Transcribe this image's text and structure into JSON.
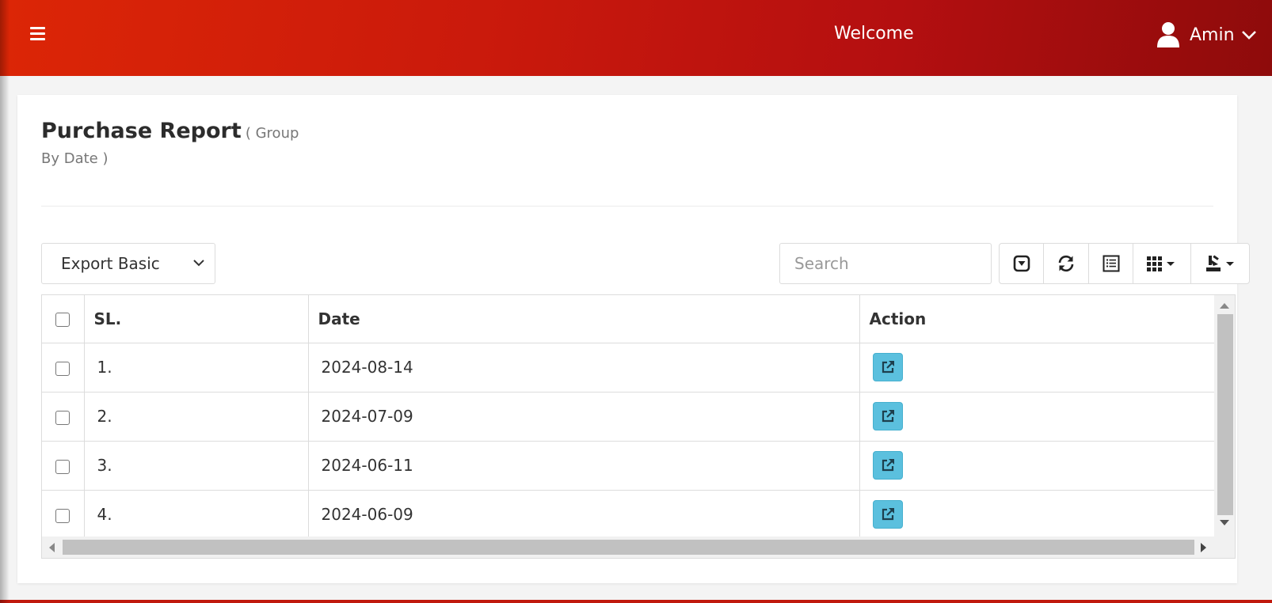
{
  "header": {
    "welcome_text": "Welcome",
    "user_name": "Amin",
    "menu_icon": "hamburger-icon",
    "user_icon": "user-icon",
    "bg_color": "#c9190c"
  },
  "report": {
    "title": "Purchase Report",
    "subtitle": "( Group By Date )"
  },
  "controls": {
    "export_select_value": "Export Basic",
    "search_placeholder": "Search",
    "toolbar_icons": [
      "toggle-icon",
      "refresh-icon",
      "list-view-icon",
      "columns-grid-icon",
      "export-icon"
    ]
  },
  "table": {
    "columns": [
      "SL.",
      "Date",
      "Action"
    ],
    "rows": [
      {
        "sl": "1.",
        "date": "2024-08-14"
      },
      {
        "sl": "2.",
        "date": "2024-07-09"
      },
      {
        "sl": "3.",
        "date": "2024-06-11"
      },
      {
        "sl": "4.",
        "date": "2024-06-09"
      }
    ],
    "action_icon": "external-link-icon",
    "action_color": "#5bc0de"
  }
}
